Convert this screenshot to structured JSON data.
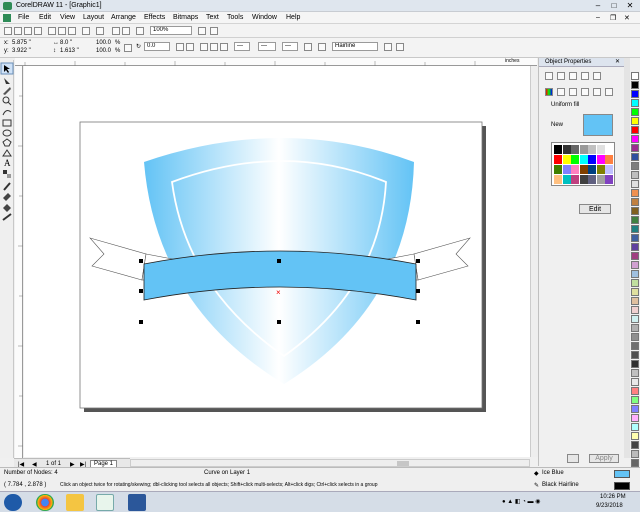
{
  "window": {
    "title": "CorelDRAW 11 - [Graphic1]"
  },
  "menu": [
    "File",
    "Edit",
    "View",
    "Layout",
    "Arrange",
    "Effects",
    "Bitmaps",
    "Text",
    "Tools",
    "Window",
    "Help"
  ],
  "standard_toolbar": {
    "zoom": "100%"
  },
  "property_bar": {
    "x": "5.875 \"",
    "y": "3.922 \"",
    "w": "8.0 \"",
    "h": "1.613 \"",
    "scale_x": "100.0",
    "scale_y": "100.0",
    "pct": "%",
    "rotation": "0.0",
    "outline": "Hairline"
  },
  "ruler": {
    "unit": "inches"
  },
  "docker": {
    "title": "Object Properties",
    "fill_label": "Uniform fill",
    "new_label": "New",
    "edit_button": "Edit",
    "apply_button": "Apply",
    "current_fill": "#63c3f5",
    "grid": [
      "#000000",
      "#333333",
      "#666666",
      "#999999",
      "#c0c0c0",
      "#e0e0e0",
      "#ffffff",
      "#ff0000",
      "#ffff00",
      "#00ff00",
      "#00ffff",
      "#0000ff",
      "#ff00ff",
      "#ff8040",
      "#408000",
      "#8080ff",
      "#ff80c0",
      "#804000",
      "#004080",
      "#808000",
      "#c0c0ff",
      "#ffc080",
      "#00c0c0",
      "#c04080",
      "#404040",
      "#606080",
      "#a0a0a0",
      "#8040c0"
    ]
  },
  "palette": [
    "#ffffff",
    "#000000",
    "#0000ff",
    "#00ffff",
    "#00ff00",
    "#ffff00",
    "#ff0000",
    "#ff00ff",
    "#9c2c8f",
    "#2f4f9f",
    "#7f7f7f",
    "#bfbfbf",
    "#e0e0e0",
    "#f09050",
    "#c08040",
    "#806020",
    "#408040",
    "#208080",
    "#4060a0",
    "#6040a0",
    "#a04080",
    "#d0a0d0",
    "#a0c0e0",
    "#c0e0a0",
    "#e0e0a0",
    "#e0c0a0",
    "#f0d0d0",
    "#d0f0f0",
    "#b0b0b0",
    "#909090",
    "#707070",
    "#505050",
    "#303030",
    "#c0c0c0",
    "#e8e8e8",
    "#ff8080",
    "#80ff80",
    "#8080ff",
    "#ffb0ff",
    "#b0ffff",
    "#ffffb0",
    "#444444",
    "#bbbbbb",
    "#666666"
  ],
  "pagebar": {
    "pages": "1 of 1",
    "tab": "Page 1"
  },
  "status": {
    "nodes": "Number of Nodes: 4",
    "object": "Curve on Layer 1",
    "coords": "( 7.784 , 2.878 )",
    "hint": "Click an object twice for rotating/skewing; dbl-clicking tool selects all objects; Shift+click multi-selects; Alt+click digs; Ctrl+click selects in a group",
    "fill_name": "Ice Blue",
    "fill_color": "#63c3f5",
    "outline_name": "Black  Hairline",
    "outline_color": "#000000"
  },
  "taskbar": {
    "time": "10:26 PM",
    "date": "9/23/2018"
  },
  "canvas": {
    "selection_center": "×"
  }
}
